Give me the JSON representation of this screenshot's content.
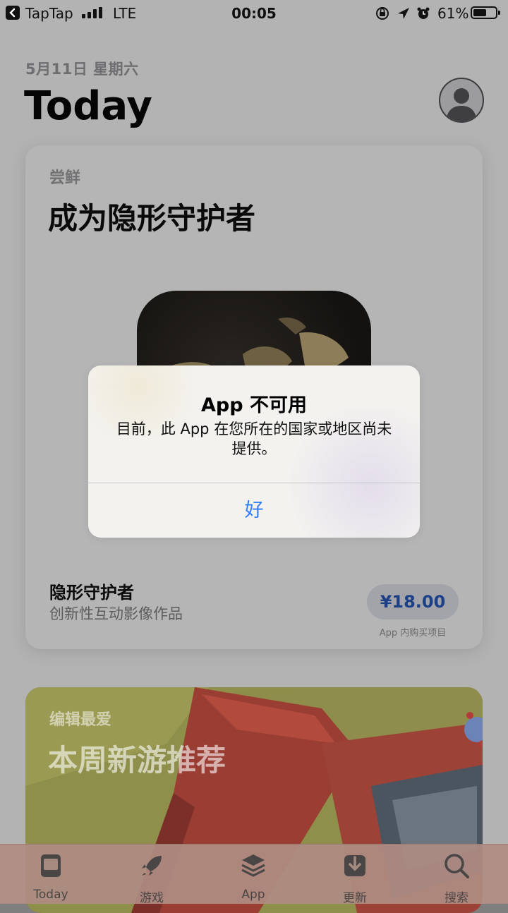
{
  "status_bar": {
    "carrier": "TapTap",
    "network": "LTE",
    "time": "00:05",
    "battery_percent": "61%",
    "battery_level": 0.61
  },
  "header": {
    "date": "5月11日 星期六",
    "title": "Today"
  },
  "feature_card": {
    "eyebrow": "尝鲜",
    "headline": "成为隐形守护者",
    "app_name": "隐形守护者",
    "app_subtitle": "创新性互动影像作品",
    "price": "¥18.00",
    "price_note": "App 内购买项目"
  },
  "second_card": {
    "eyebrow": "编辑最爱",
    "headline": "本周新游推荐"
  },
  "alert": {
    "title": "App 不可用",
    "message": "目前，此 App 在您所在的国家或地区尚未提供。",
    "button": "好"
  },
  "tab_bar": {
    "tabs": [
      {
        "label": "Today",
        "icon": "today-icon"
      },
      {
        "label": "游戏",
        "icon": "rocket-icon"
      },
      {
        "label": "App",
        "icon": "layers-icon"
      },
      {
        "label": "更新",
        "icon": "download-icon"
      },
      {
        "label": "搜索",
        "icon": "search-icon"
      }
    ]
  },
  "colors": {
    "accent": "#2f7cf6",
    "price_text": "#1d3f86"
  }
}
